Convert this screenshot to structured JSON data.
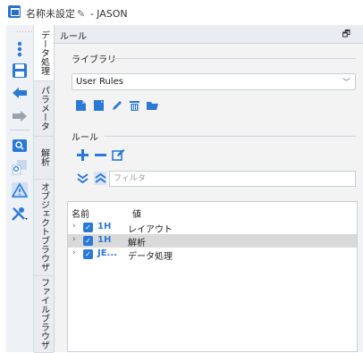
{
  "window": {
    "title_name": "名称未設定",
    "title_suffix": " - JASON"
  },
  "vertical_tabs": [
    {
      "label": "データ処理"
    },
    {
      "label": "パラメータ"
    },
    {
      "label": "解析"
    },
    {
      "label": "オブジェクトブラウザ"
    },
    {
      "label": "ファイルブラウザ"
    }
  ],
  "panel": {
    "title": "ルール",
    "library_label": "ライブラリ",
    "library_value": "User Rules",
    "rules_label": "ルール",
    "filter_placeholder": "フィルタ"
  },
  "tree": {
    "col_name": "名前",
    "col_value": "値",
    "rows": [
      {
        "name": "1H",
        "value": "レイアウト",
        "selected": false,
        "checked": true
      },
      {
        "name": "1H",
        "value": "解析",
        "selected": true,
        "checked": true
      },
      {
        "name": "JE...",
        "value": "データ処理",
        "selected": false,
        "checked": true
      }
    ]
  },
  "colors": {
    "accent": "#2b79d6",
    "toolbar_bg": "#eef1f6",
    "panel_bg": "#f3f3f3",
    "selected_row": "#d9d9d9"
  }
}
